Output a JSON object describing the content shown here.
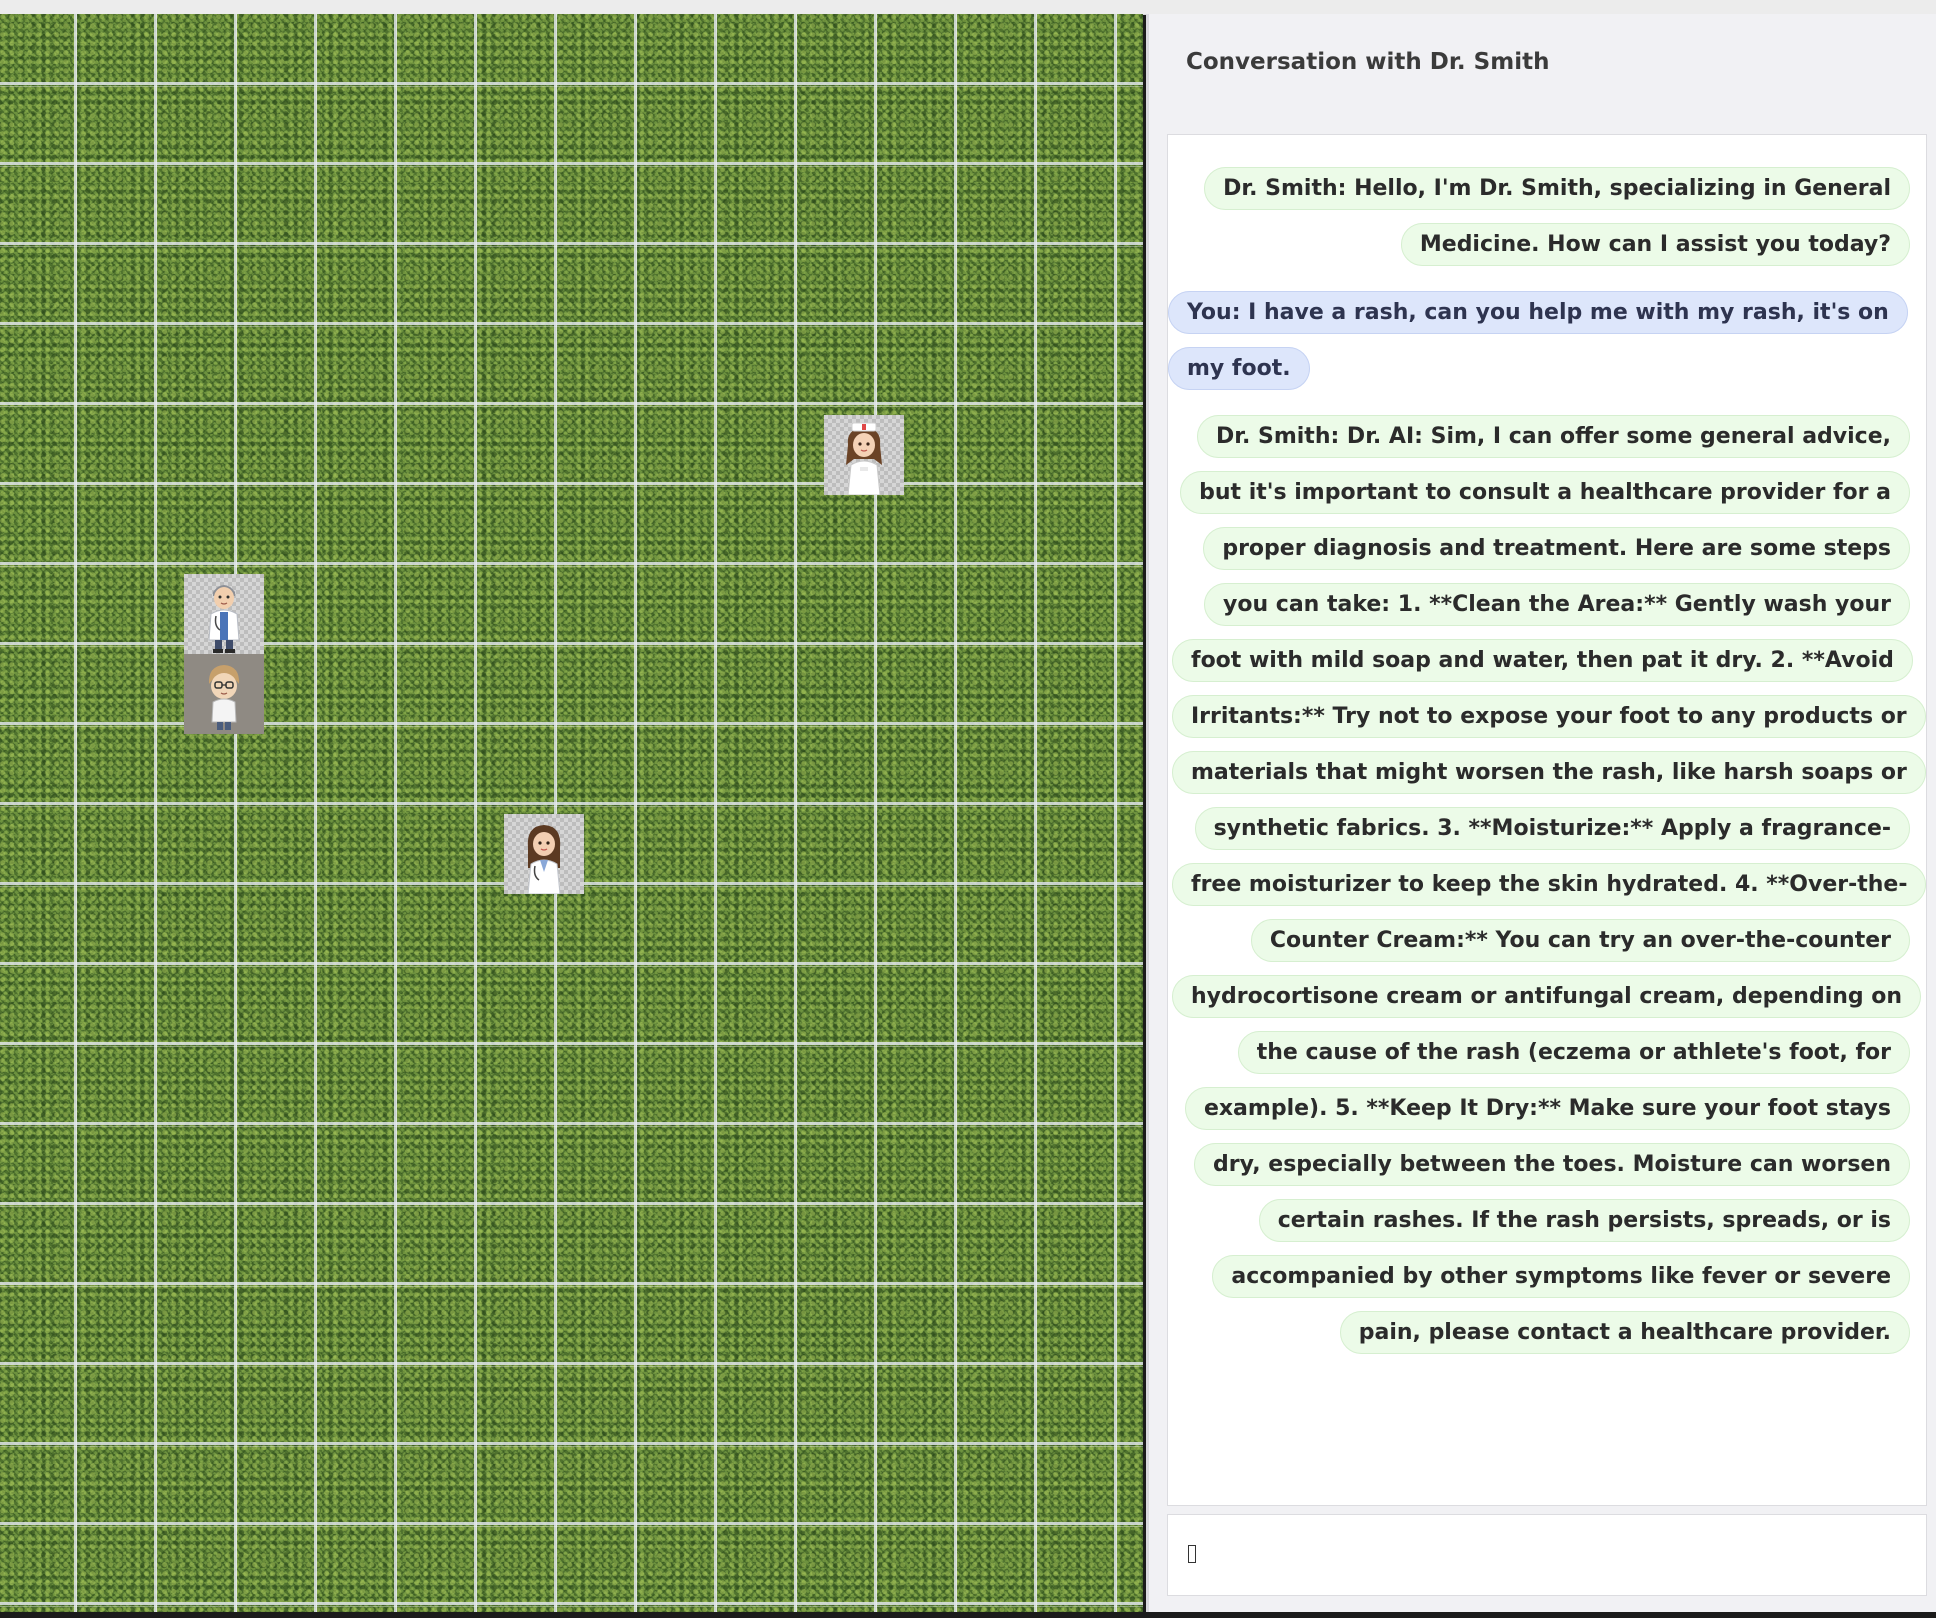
{
  "chat": {
    "title": "Conversation with Dr. Smith",
    "messages": [
      {
        "role": "npc",
        "text": "Dr. Smith: Hello, I'm Dr. Smith, specializing in General Medicine. How can I assist you today?"
      },
      {
        "role": "user",
        "text": "You: I have a rash, can you help me with my rash, it's on my foot."
      },
      {
        "role": "npc",
        "text": "Dr. Smith: Dr. AI: Sim, I can offer some general advice, but it's important to consult a healthcare provider for a proper diagnosis and treatment. Here are some steps you can take: 1. **Clean the Area:** Gently wash your foot with mild soap and water, then pat it dry. 2. **Avoid Irritants:** Try not to expose your foot to any products or materials that might worsen the rash, like harsh soaps or synthetic fabrics. 3. **Moisturize:** Apply a fragrance-free moisturizer to keep the skin hydrated. 4. **Over-the-Counter Cream:** You can try an over-the-counter hydrocortisone cream or antifungal cream, depending on the cause of the rash (eczema or athlete's foot, for example). 5. **Keep It Dry:** Make sure your foot stays dry, especially between the toes. Moisture can worsen certain rashes. If the rash persists, spreads, or is accompanied by other symptoms like fever or severe pain, please contact a healthcare provider."
      }
    ],
    "input": {
      "value": "",
      "placeholder": ""
    }
  },
  "game": {
    "characters": [
      {
        "id": "nurse",
        "icon": "nurse-sprite"
      },
      {
        "id": "doctor-male",
        "icon": "male-doctor-sprite"
      },
      {
        "id": "player",
        "icon": "player-sprite"
      },
      {
        "id": "doctor-female",
        "icon": "female-doctor-sprite"
      }
    ]
  },
  "colors": {
    "npc_bubble": "#ecfbe8",
    "user_bubble": "#dde6fb",
    "grass": "#587a32",
    "panel_bg": "#f1f1f4"
  }
}
